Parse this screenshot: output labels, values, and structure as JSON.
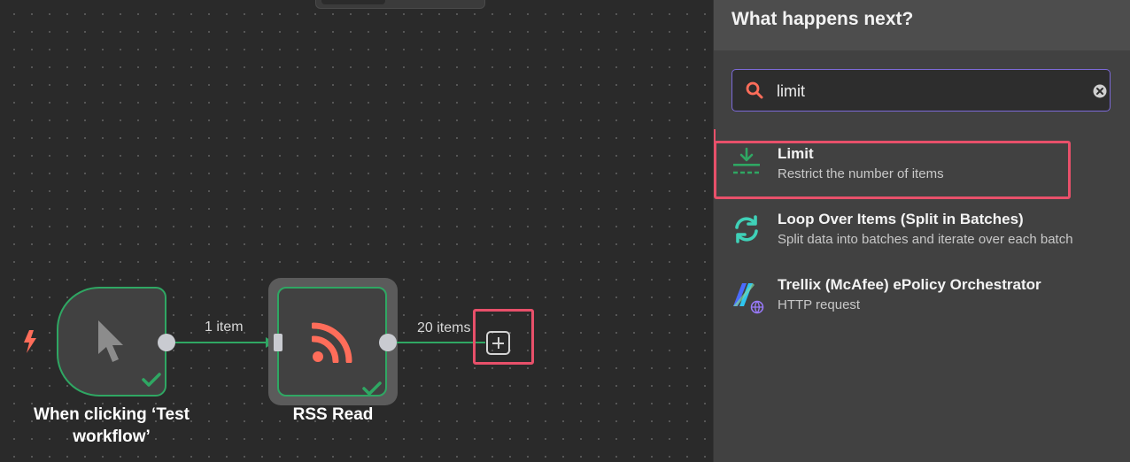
{
  "canvas": {
    "trigger_node": {
      "title": "When clicking ‘Test workflow’",
      "icon": "cursor-icon",
      "status": "success"
    },
    "rss_node": {
      "title": "RSS Read",
      "icon": "rss-icon",
      "status": "success"
    },
    "connection_1_label": "1 item",
    "connection_2_label": "20 items",
    "add_node_icon": "plus-square-icon",
    "trigger_marker_icon": "bolt-icon"
  },
  "panel": {
    "title": "What happens next?",
    "search": {
      "value": "limit",
      "placeholder": ""
    },
    "results": [
      {
        "title": "Limit",
        "description": "Restrict the number of items",
        "icon": "limit-icon"
      },
      {
        "title": "Loop Over Items (Split in Batches)",
        "description": "Split data into batches and iterate over each batch",
        "icon": "loop-icon"
      },
      {
        "title": "Trellix (McAfee) ePolicy Orchestrator",
        "description": "HTTP request",
        "icon": "trellix-logo-icon"
      }
    ]
  },
  "colors": {
    "success_green": "#2fa763",
    "highlight_red": "#e8506a",
    "accent_orange": "#ff6d5a",
    "search_border": "#7c6ad8"
  }
}
